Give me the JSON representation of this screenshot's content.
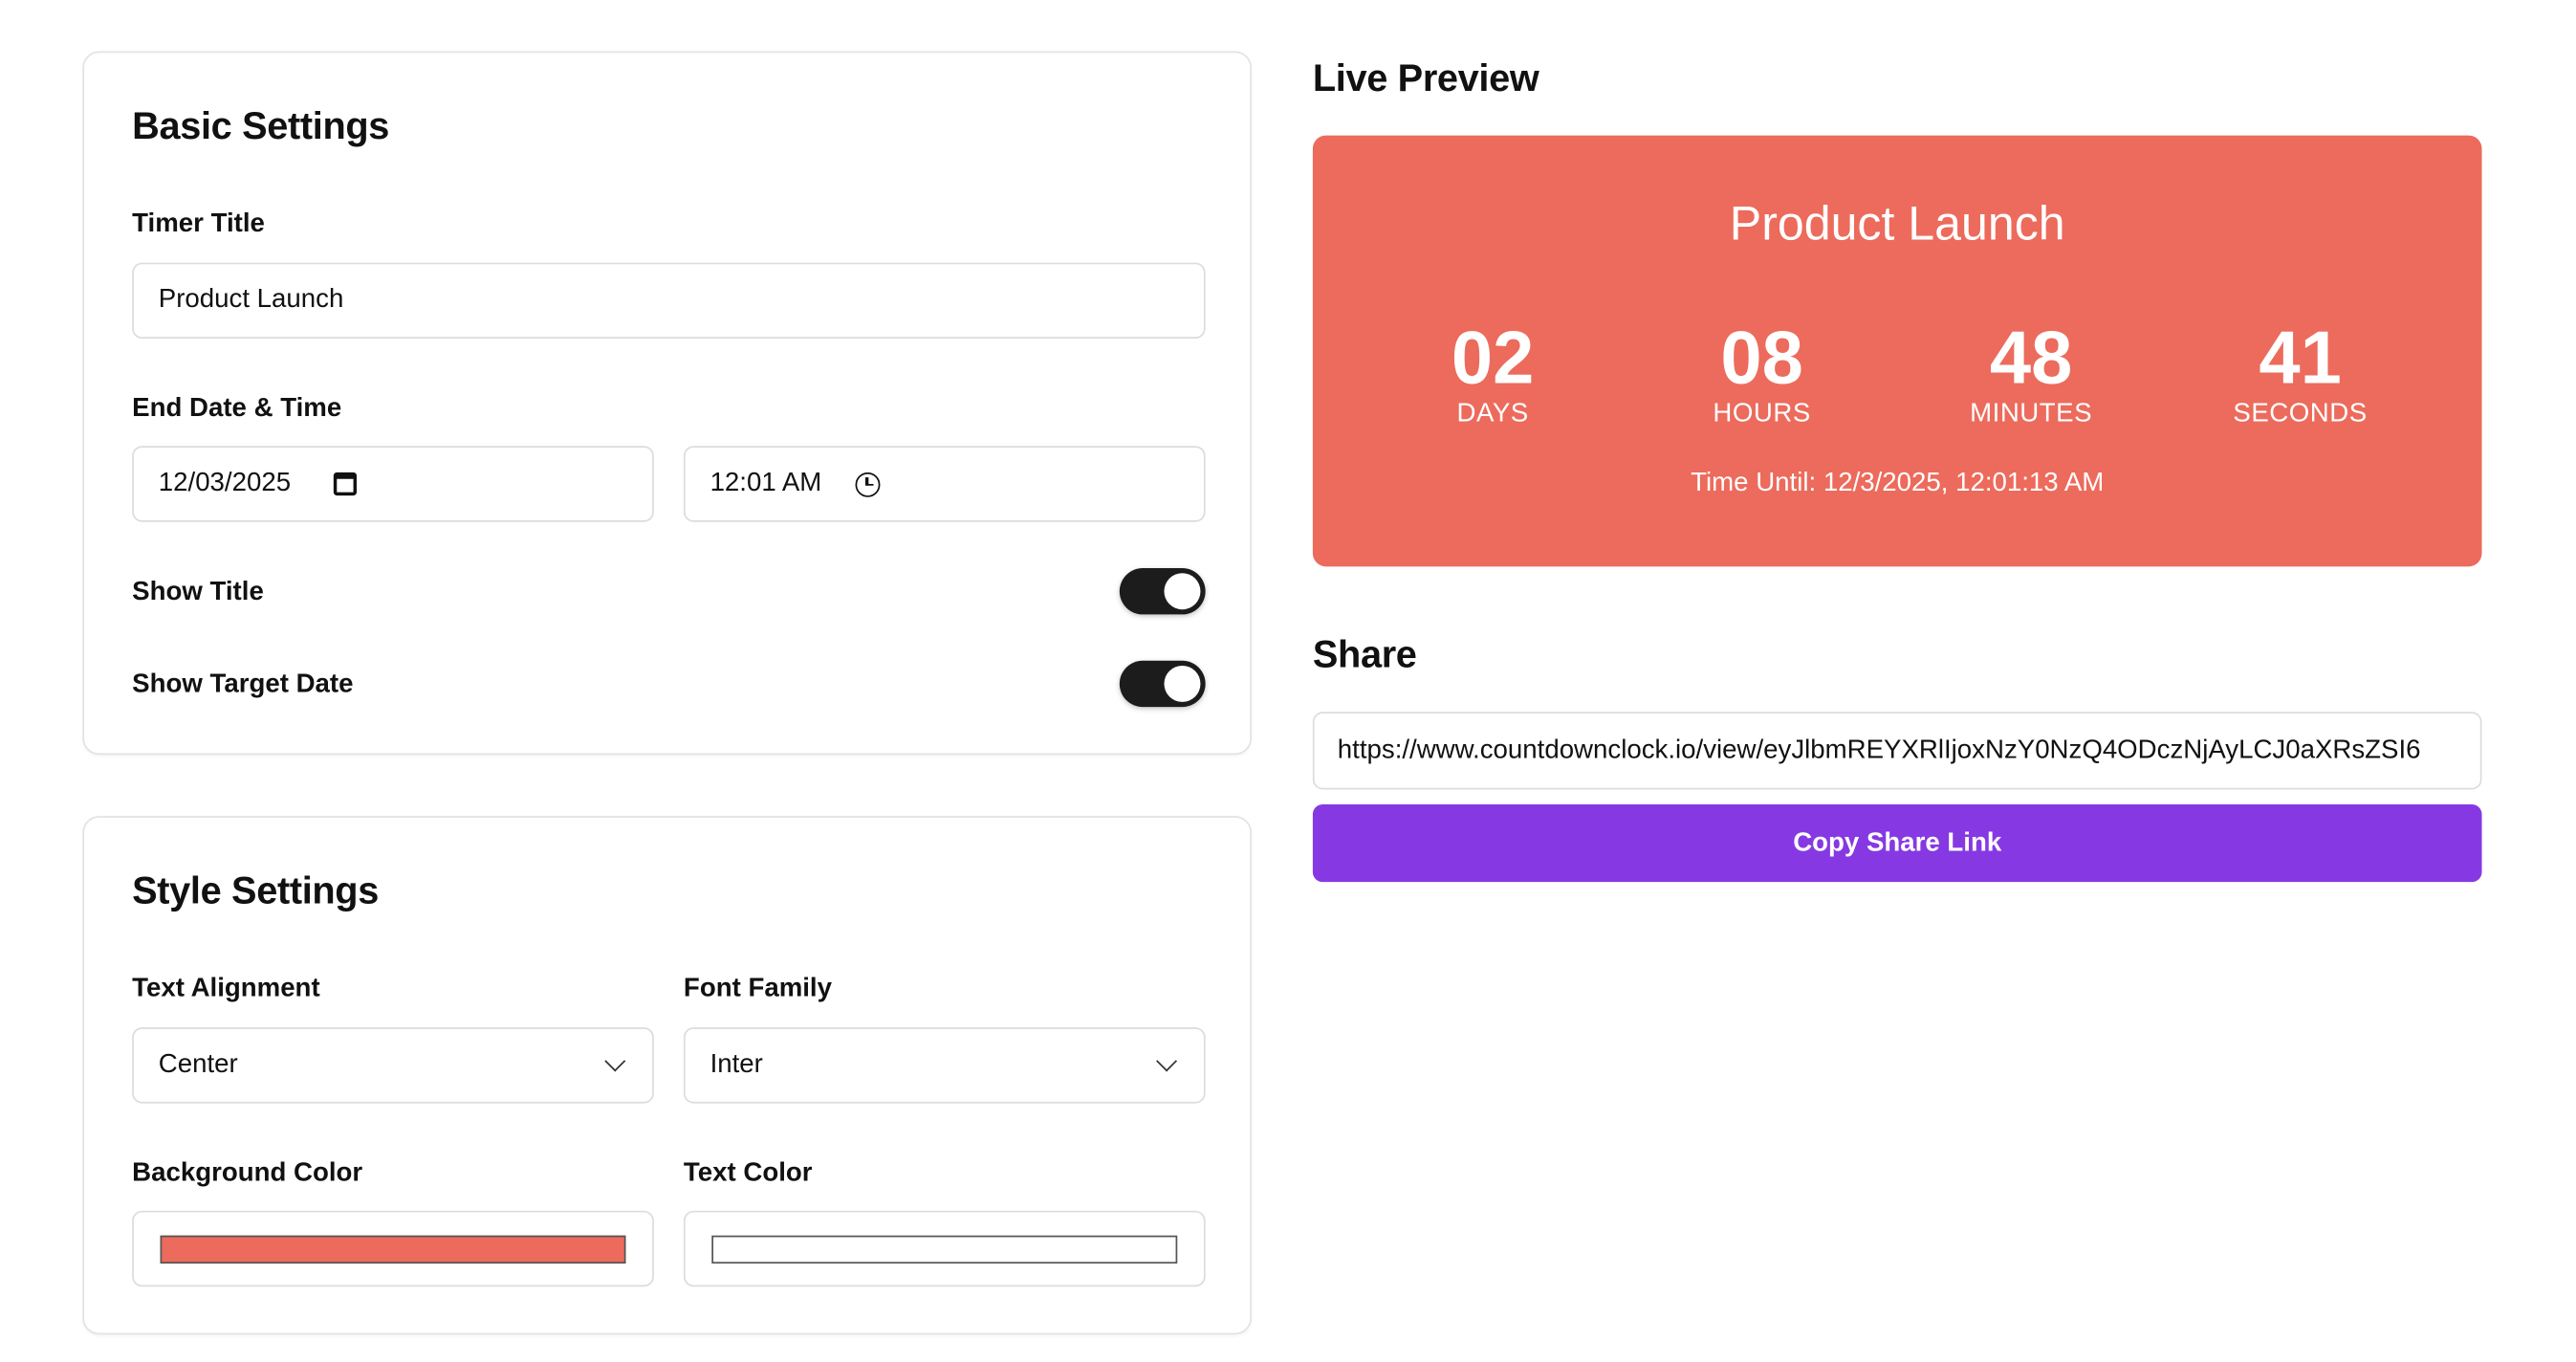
{
  "basic_settings": {
    "heading": "Basic Settings",
    "timer_title_label": "Timer Title",
    "timer_title_value": "Product Launch",
    "end_label": "End Date & Time",
    "date_value": "12/03/2025",
    "time_value": "12:01 AM",
    "show_title_label": "Show Title",
    "show_title_on": true,
    "show_target_label": "Show Target Date",
    "show_target_on": true
  },
  "style_settings": {
    "heading": "Style Settings",
    "alignment_label": "Text Alignment",
    "alignment_value": "Center",
    "font_label": "Font Family",
    "font_value": "Inter",
    "bg_label": "Background Color",
    "bg_color": "#EC6B5C",
    "text_label": "Text Color",
    "text_color": "#FFFFFF"
  },
  "preview": {
    "heading": "Live Preview",
    "title": "Product Launch",
    "units": [
      {
        "value": "02",
        "label": "DAYS"
      },
      {
        "value": "08",
        "label": "HOURS"
      },
      {
        "value": "48",
        "label": "MINUTES"
      },
      {
        "value": "41",
        "label": "SECONDS"
      }
    ],
    "target_text": "Time Until: 12/3/2025, 12:01:13 AM"
  },
  "share": {
    "heading": "Share",
    "url": "https://www.countdownclock.io/view/eyJlbmREYXRlIjoxNzY0NzQ4ODczNjAyLCJ0aXRsZSI6",
    "copy_label": "Copy Share Link",
    "button_color": "#8639E3"
  }
}
